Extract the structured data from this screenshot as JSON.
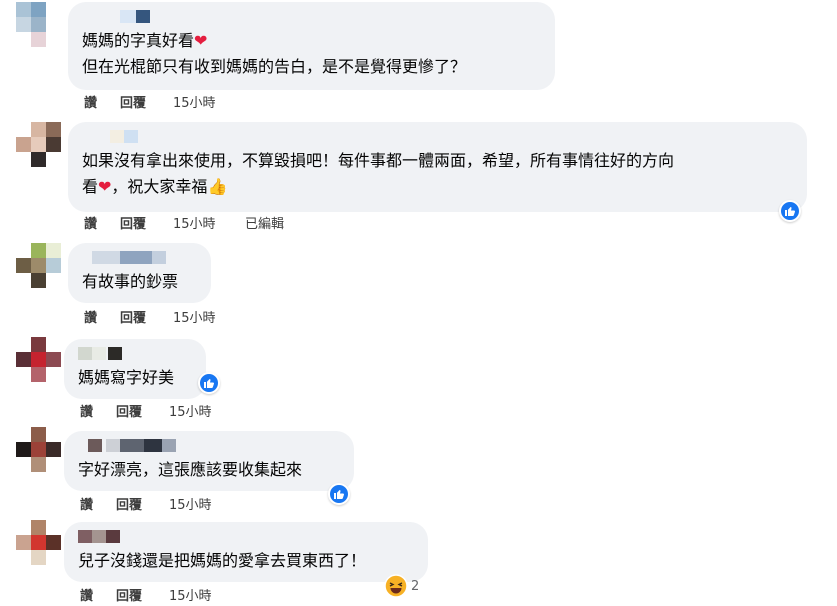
{
  "comments": [
    {
      "id": 1,
      "lines": [
        "媽媽的字真好看",
        "但在光棍節只有收到媽媽的告白，是不是覺得更慘了？"
      ],
      "actions": {
        "reply_like": "讚",
        "reply": "回覆",
        "time": "15小時",
        "edited": ""
      }
    },
    {
      "id": 2,
      "lines": [
        "如果沒有拿出來使用，不算毀損吧！每件事都一體兩面，希望，所有事情往好的方向",
        "看",
        "，祝大家幸福"
      ],
      "actions": {
        "reply_like": "讚",
        "reply": "回覆",
        "time": "15小時",
        "edited": "已編輯"
      },
      "reaction": "like"
    },
    {
      "id": 3,
      "lines": [
        "有故事的鈔票"
      ],
      "actions": {
        "reply_like": "讚",
        "reply": "回覆",
        "time": "15小時",
        "edited": ""
      }
    },
    {
      "id": 4,
      "lines": [
        "媽媽寫字好美"
      ],
      "actions": {
        "reply_like": "讚",
        "reply": "回覆",
        "time": "15小時",
        "edited": ""
      },
      "reaction": "like"
    },
    {
      "id": 5,
      "lines": [
        "字好漂亮，這張應該要收集起來"
      ],
      "actions": {
        "reply_like": "讚",
        "reply": "回覆",
        "time": "15小時",
        "edited": ""
      },
      "reaction": "like"
    },
    {
      "id": 6,
      "lines": [
        "兒子沒錢還是把媽媽的愛拿去買東西了！"
      ],
      "actions": {
        "reply_like": "讚",
        "reply": "回覆",
        "time": "15小時",
        "edited": ""
      },
      "reaction": "haha",
      "reaction_count": "2"
    }
  ],
  "colors": {
    "bubble": "#f0f2f5",
    "like_blue": "#1877f2",
    "heart": "#e41e3f"
  },
  "icons": {
    "like": "thumbs-up-icon",
    "haha": "laughing-emoji-icon",
    "heart": "heart-emoji-icon",
    "thumb": "thumbs-up-emoji-icon"
  }
}
